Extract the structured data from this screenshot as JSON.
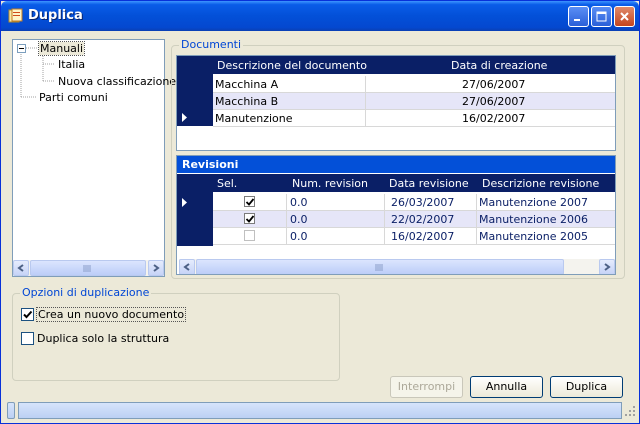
{
  "window": {
    "title": "Duplica"
  },
  "tree": {
    "root": "Manuali",
    "children": [
      "Italia",
      "Nuova classificazione"
    ],
    "sibling": "Parti comuni"
  },
  "documenti": {
    "legend": "Documenti",
    "columns": [
      "Descrizione del documento",
      "Data di creazione"
    ],
    "rows": [
      {
        "descrizione": "Macchina A",
        "data": "27/06/2007"
      },
      {
        "descrizione": "Macchina B",
        "data": "27/06/2007"
      },
      {
        "descrizione": "Manutenzione",
        "data": "16/02/2007"
      }
    ]
  },
  "revisioni": {
    "title": "Revisioni",
    "columns": [
      "Sel.",
      "Num. revision",
      "Data revisione",
      "Descrizione revisione"
    ],
    "rows": [
      {
        "sel": true,
        "num": "0.0",
        "data": "26/03/2007",
        "descrizione": "Manutenzione 2007"
      },
      {
        "sel": true,
        "num": "0.0",
        "data": "22/02/2007",
        "descrizione": "Manutenzione 2006"
      },
      {
        "sel": false,
        "num": "0.0",
        "data": "16/02/2007",
        "descrizione": "Manutenzione 2005"
      }
    ]
  },
  "opzioni": {
    "legend": "Opzioni di duplicazione",
    "crea_label": "Crea un nuovo documento",
    "crea_checked": true,
    "struttura_label": "Duplica solo la struttura",
    "struttura_checked": false
  },
  "buttons": {
    "interrompi": "Interrompi",
    "annulla": "Annulla",
    "duplica": "Duplica"
  },
  "colors": {
    "header": "#0a1f66",
    "title_bar": "#0350d8",
    "accent": "#0046d5"
  }
}
